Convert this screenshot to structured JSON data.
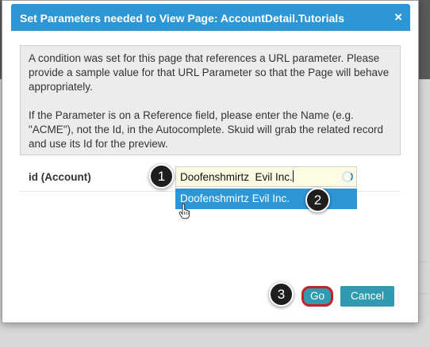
{
  "dialog": {
    "title": "Set Parameters needed to View Page: AccountDetail.Tutorials",
    "close_label": "×",
    "notice": {
      "paragraph1": "A condition was set for this page that references a URL parameter. Please provide a sample value for that URL Parameter so that the Page will behave appropriately.",
      "paragraph2": "If the Parameter is on a Reference field, please enter the Name (e.g. \"ACME\"), not the Id, in the Autocomplete. Skuid will grab the related record and use its Id for the preview."
    },
    "field": {
      "label": "id (Account)",
      "value": "Doofenshmirtz  Evil Inc.",
      "suggestion": "Doofenshmirtz Evil Inc."
    },
    "buttons": {
      "go": "Go",
      "cancel": "Cancel"
    }
  },
  "steps": {
    "one": "1",
    "two": "2",
    "three": "3"
  },
  "colors": {
    "titlebar": "#2d97d6",
    "button": "#2f9ab0",
    "highlight_ring": "#c81f2c"
  }
}
